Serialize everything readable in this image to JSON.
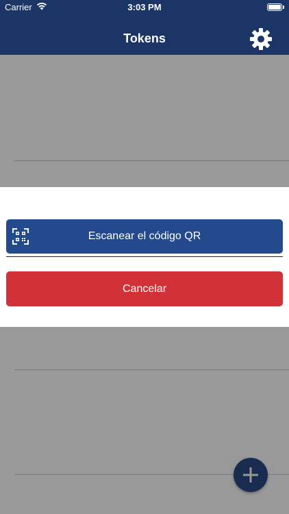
{
  "status_bar": {
    "carrier": "Carrier",
    "time": "3:03 PM",
    "battery_level": 1.0
  },
  "nav": {
    "title": "Tokens",
    "settings_icon": "gear-icon"
  },
  "sheet": {
    "scan_label": "Escanear el código QR",
    "scan_icon": "qr-scan-icon",
    "cancel_label": "Cancelar"
  },
  "fab": {
    "icon": "plus-icon"
  },
  "colors": {
    "nav_background": "#1a3566",
    "scan_button": "#234a8c",
    "cancel_button": "#d13237",
    "fab": "#2a4a84"
  }
}
